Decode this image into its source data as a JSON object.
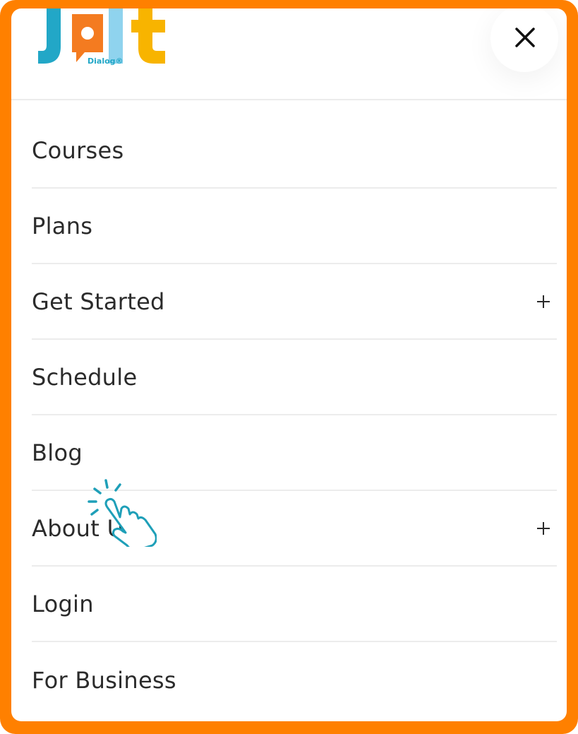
{
  "brand": {
    "logo_word": "JOLT",
    "logo_sub": "Dialog®",
    "colors": {
      "frame": "#ff8000",
      "teal": "#22a7c7",
      "orange": "#f47b20",
      "light_blue": "#8fd3ee",
      "yellow": "#f8b400"
    }
  },
  "header": {
    "close_icon": "close-icon"
  },
  "menu": {
    "items": [
      {
        "label": "Courses",
        "expandable": false
      },
      {
        "label": "Plans",
        "expandable": false
      },
      {
        "label": "Get Started",
        "expandable": true,
        "icon": "plus-icon"
      },
      {
        "label": "Schedule",
        "expandable": false
      },
      {
        "label": "Blog",
        "expandable": false
      },
      {
        "label": "About Us",
        "expandable": true,
        "icon": "plus-icon"
      },
      {
        "label": "Login",
        "expandable": false
      },
      {
        "label": "For Business",
        "expandable": false
      }
    ]
  },
  "overlay": {
    "cursor_icon": "hand-pointer-icon"
  }
}
